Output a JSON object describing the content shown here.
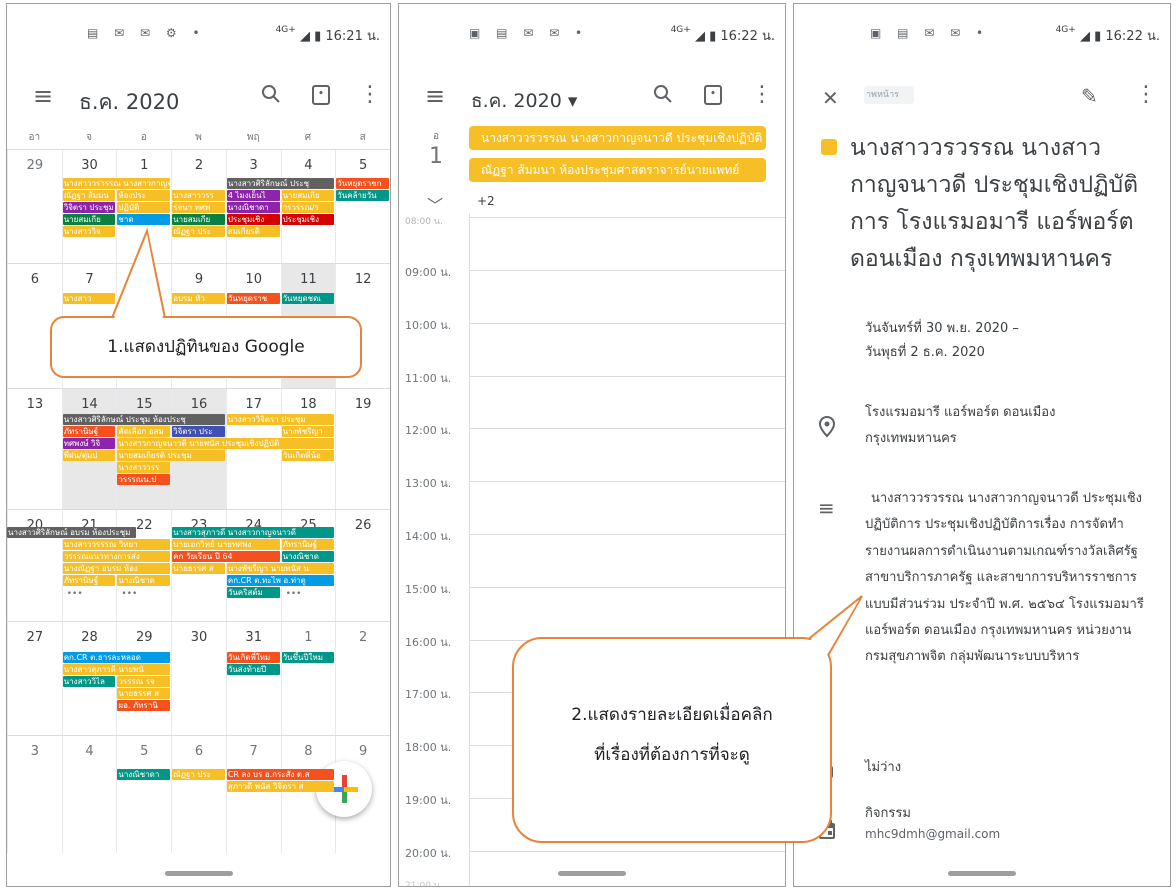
{
  "status": {
    "time": "16:21 น.",
    "time2": "16:22 น.",
    "time3": "16:22 น.",
    "network": "4G+"
  },
  "month_view": {
    "title": "ธ.ค. 2020",
    "weekdays": [
      "อา",
      "จ",
      "อ",
      "พ",
      "พฤ",
      "ศ",
      "ส"
    ],
    "weeks": [
      [
        "29",
        "30",
        "1",
        "2",
        "3",
        "4",
        "5"
      ],
      [
        "6",
        "7",
        "8",
        "9",
        "10",
        "11",
        "12"
      ],
      [
        "13",
        "14",
        "15",
        "16",
        "17",
        "18",
        "19"
      ],
      [
        "20",
        "21",
        "22",
        "23",
        "24",
        "25",
        "26"
      ],
      [
        "27",
        "28",
        "29",
        "30",
        "31",
        "1",
        "2"
      ],
      [
        "3",
        "4",
        "5",
        "6",
        "7",
        "8",
        "9"
      ]
    ],
    "events": {
      "w1a": "นางสาววรวรรณ นางสาวกาญจนาวดี",
      "w1b": "นางสาวศิริลักษณ์ ประชุ",
      "w1c": "วันหยุดราชก",
      "w1d": "ณัฏฐา ส้มมน",
      "w1e": "ห้องประ",
      "w1f": "นางสาววรร",
      "w1g": "4 ไมงเย็นไ",
      "w1h": "นายสมเกีย",
      "w1i": "วันคล้ายวัน",
      "w1j": "วิจิตรา ประชุม",
      "w1k": "ปฏิบัติ",
      "w1l": "รจนา ทศพ",
      "w1m": "นางณิชาดา",
      "w1n": "วรวรรณ/ร",
      "w1o": "นายสมเกีย",
      "w1p": "ชาด",
      "w1q": "นายสมเกีย",
      "w1r": "ประชุมเชิง",
      "w1s": "ประชุมเชิง",
      "w1t": "นางสาววิจ",
      "w1u": "ณัฏฐา ประ",
      "w1v": "สมเกียรติ",
      "w2a": "นางสาว",
      "w2b": "อบรม หัว",
      "w2c": "วันหยุดราช",
      "w2d": "วันหยุดชดเ",
      "w3a": "นางสาวศิริลักษณ์ ประชุม ห้องประชุ",
      "w3b": "นางสาววิจิตรา ประชุม",
      "w3c": "ภัทรานิษฐ์",
      "w3d": "คัดเลือก อสม",
      "w3e": "วิจิตรา ประ",
      "w3f": "นางพัชรีญา",
      "w3g": "ทศพงษ์ วิจิ",
      "w3h": "นางสาวกาญจนาวดี นายพนัส ประชุมเชิงปฏิบัติ",
      "w3i": "พี่ฝน/ตุ่มป",
      "w3j": "นายสมเกียรติ ประชุม",
      "w3k": "วันเกิดพี่น้อ",
      "w3l": "นางสาววรร",
      "w3m": "วรรรณน.ป",
      "w4a": "นางสาวศิริลักษณ์ อบรม ห้องประชุม",
      "w4b": "นางสาวสุภาวดี นางสาวกาญจนาวดี",
      "w4c": "นางสาววรรรณ วิทยา",
      "w4d": "นายเอกวิทย์ นายทศพง",
      "w4e": "ภัทรานิษฐ์",
      "w4f": "วรรรณแนวทางการส่ง",
      "w4g": "คก วัยเรียน ปี 64",
      "w4h": "นางณิชาด",
      "w4i": "นางณัฏฐา อบรม ห้อง",
      "w4j": "นายธรรศ ส",
      "w4k": "นางพัชรีญา นายพนัส น",
      "w4l": "ภัทรานิษฐ์",
      "w4m": "นางณิชาด",
      "w4n": "คก.CR ต.ทะไพ อ.ท่าตู",
      "w4o": "วันคริสต์ม",
      "w5a": "คก.CR ต.ธารละหลอด",
      "w5b": "วันเกิดพี่ใหม",
      "w5c": "วันขึ้นปีใหม",
      "w5d": "นางสาวสุภาวดี นายพนั",
      "w5e": "วันส่งท้ายปี",
      "w5f": "นางสาววิไล",
      "w5g": "วรรรณ รจ",
      "w5h": "นายธรรศ ส",
      "w5i": "ผอ. ภัทรานิ",
      "w6a": "นางณิชาดา",
      "w6b": "ณัฏฐา ประ",
      "w6c": "CR ลง บร อ.กระสัง ต.ส",
      "w6d": "สุภาวดี พนัส วิจิตรา ส"
    },
    "more_label": "•••",
    "fab_label": "+"
  },
  "callout1": "1.แสดงปฏิทินของ Google",
  "day_view": {
    "title": "ธ.ค. 2020 ▾",
    "dow": "อ",
    "day": "1",
    "event1": "นางสาววรวรรณ นางสาวกาญจนาวดี ประชุมเชิงปฏิบัติ",
    "event2": "ณัฏฐา ส้มมนา ห้องประชุมศาสตราจารย์นายแพทย์",
    "more": "+2",
    "partial_hour": "08:00 น.",
    "hours": [
      "09:00 น.",
      "10:00 น.",
      "11:00 น.",
      "12:00 น.",
      "13:00 น.",
      "14:00 น.",
      "15:00 น.",
      "16:00 น.",
      "17:00 น.",
      "18:00 น.",
      "19:00 น.",
      "20:00 น."
    ],
    "last_hour": "21:00 น."
  },
  "callout2_line1": "2.แสดงรายละเอียดเมื่อคลิก",
  "callout2_line2": "ที่เรื่องที่ต้องการที่จะดู",
  "detail": {
    "header_hint": "าพหน้าร",
    "title": "นางสาววรวรรณ นางสาวกาญจนาวดี ประชุมเชิงปฏิบัติการ โรงแรมอมารี แอร์พอร์ต ดอนเมือง กรุงเทพมหานคร",
    "date_line1": "วันจันทร์ที่ 30 พ.ย. 2020 –",
    "date_line2": "วันพุธที่ 2 ธ.ค. 2020",
    "location_line1": "โรงแรมอมารี แอร์พอร์ต ดอนเมือง",
    "location_line2": "กรุงเทพมหานคร",
    "desc": "นางสาววรวรรณ นางสาวกาญจนาวดี ประชุมเชิงปฏิบัติการ ประชุมเชิงปฏิบัติการเรื่อง การจัดทำรายงานผลการดำเนินงานตามเกณฑ์รางวัลเลิศรัฐ สาขาบริการภาครัฐ และสาขาการบริหารราชการแบบมีส่วนร่วม ประจำปี พ.ศ. ๒๕๖๔ โรงแรมอมารี แอร์พอร์ต ดอนเมือง กรุงเทพมหานคร หน่วยงาน กรมสุขภาพจิต กลุ่มพัฒนาระบบบริหาร",
    "busy": "ไม่ว่าง",
    "calendar_name": "กิจกรรม",
    "calendar_email": "mhc9dmh@gmail.com"
  }
}
